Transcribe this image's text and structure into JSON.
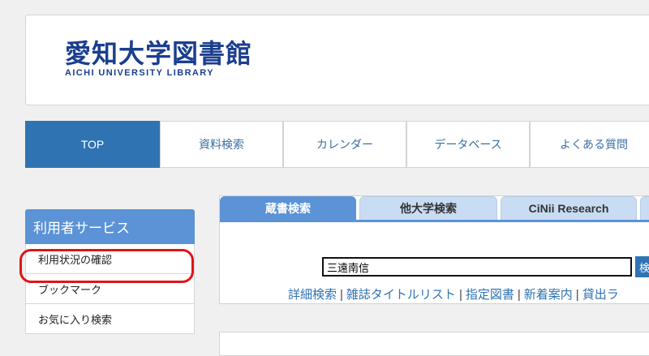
{
  "header": {
    "logo_jp": "愛知大学図書館",
    "logo_en": "AICHI UNIVERSITY LIBRARY"
  },
  "nav": {
    "items": [
      {
        "label": "TOP",
        "active": true
      },
      {
        "label": "資料検索"
      },
      {
        "label": "カレンダー"
      },
      {
        "label": "データベース"
      },
      {
        "label": "よくある質問"
      }
    ]
  },
  "sidebar": {
    "title": "利用者サービス",
    "items": [
      {
        "label": "利用状況の確認"
      },
      {
        "label": "ブックマーク"
      },
      {
        "label": "お気に入り検索"
      }
    ]
  },
  "search": {
    "tabs": [
      {
        "label": "蔵書検索",
        "active": true
      },
      {
        "label": "他大学検索"
      },
      {
        "label": "CiNii Research"
      }
    ],
    "query": "三遠南信",
    "button": "検",
    "links": [
      "詳細検索",
      "雑誌タイトルリスト",
      "指定図書",
      "新着案内",
      "貸出ラ"
    ]
  },
  "colors": {
    "brand": "#1b3f8f",
    "nav_active": "#2f73b3",
    "tab_active": "#5b93d6",
    "highlight": "#e0141a"
  }
}
